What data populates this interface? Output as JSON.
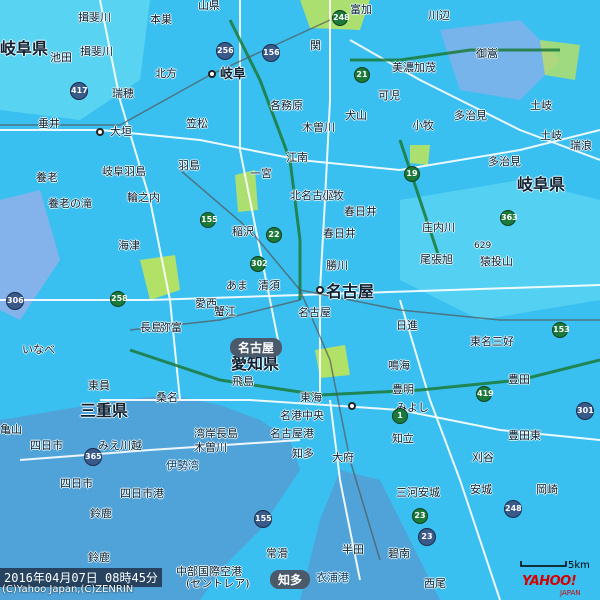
{
  "colors": {
    "sea": "#4fa3d8",
    "land_rain": "#39c0f0",
    "weak_rain": "#6fe0f4",
    "yellow_green": "#c8e650",
    "purple": "#b8a8e8",
    "road_main": "#ffffff",
    "rail": "#555555",
    "expressway": "#1b7a3a",
    "national_route": "#3a5a8a"
  },
  "labels": {
    "big": [
      "岐阜県",
      "名古屋",
      "三重県",
      "愛知県",
      "岐阜"
    ],
    "towns": [
      "揖斐川",
      "本巣",
      "山県",
      "関",
      "富加",
      "川辺",
      "池田",
      "揖斐川",
      "北方",
      "岐阜",
      "美濃加茂",
      "御嵩",
      "瑞穂",
      "各務原",
      "犬山",
      "可児",
      "多治見",
      "土岐",
      "垂井",
      "大垣",
      "笠松",
      "木曽川",
      "小牧",
      "多治見",
      "土岐",
      "瑞浪",
      "養老",
      "岐阜羽島",
      "羽島",
      "一宮",
      "江南",
      "北名古屋",
      "小牧",
      "春日井",
      "輪之内",
      "養老の滝",
      "稲沢",
      "春日井",
      "庄内川",
      "海津",
      "あま",
      "勝川",
      "尾張旭",
      "猿投山",
      "清須",
      "名古屋",
      "長島",
      "愛西",
      "蟹江",
      "名古屋",
      "日進",
      "弥富",
      "豊明",
      "東名三好",
      "いなべ",
      "鳴海",
      "豊田",
      "東員",
      "飛島",
      "大府",
      "知立",
      "桑名",
      "みよし",
      "豊田東",
      "亀山",
      "湾岸長島",
      "名港中央",
      "名古屋港",
      "刈谷",
      "安城",
      "岡崎",
      "四日市",
      "伊勢湾",
      "みえ川越",
      "木曽川",
      "東海",
      "四日市",
      "四日市港",
      "知多",
      "三河安城",
      "鈴鹿",
      "半田",
      "碧南",
      "常滑",
      "西尾",
      "衣浦港",
      "鈴鹿",
      "中部国際空港",
      "(セントレア)",
      "知多"
    ],
    "route_tags": [
      "名古屋",
      "知多"
    ],
    "expressway_numbers": [
      "21",
      "19",
      "22",
      "155",
      "258",
      "302",
      "248",
      "363",
      "153",
      "1",
      "23",
      "419"
    ],
    "national_route_numbers": [
      "256",
      "156",
      "417",
      "306",
      "365",
      "155",
      "23",
      "301",
      "248"
    ],
    "mountain_elevation": "629"
  },
  "overlay": {
    "timestamp": "2016年04月07日 08時45分",
    "credit": "(C)Yahoo Japan,(C)ZENRIN",
    "logo": "YAHOO!",
    "logo_sub": "JAPAN",
    "scale": "5km"
  }
}
